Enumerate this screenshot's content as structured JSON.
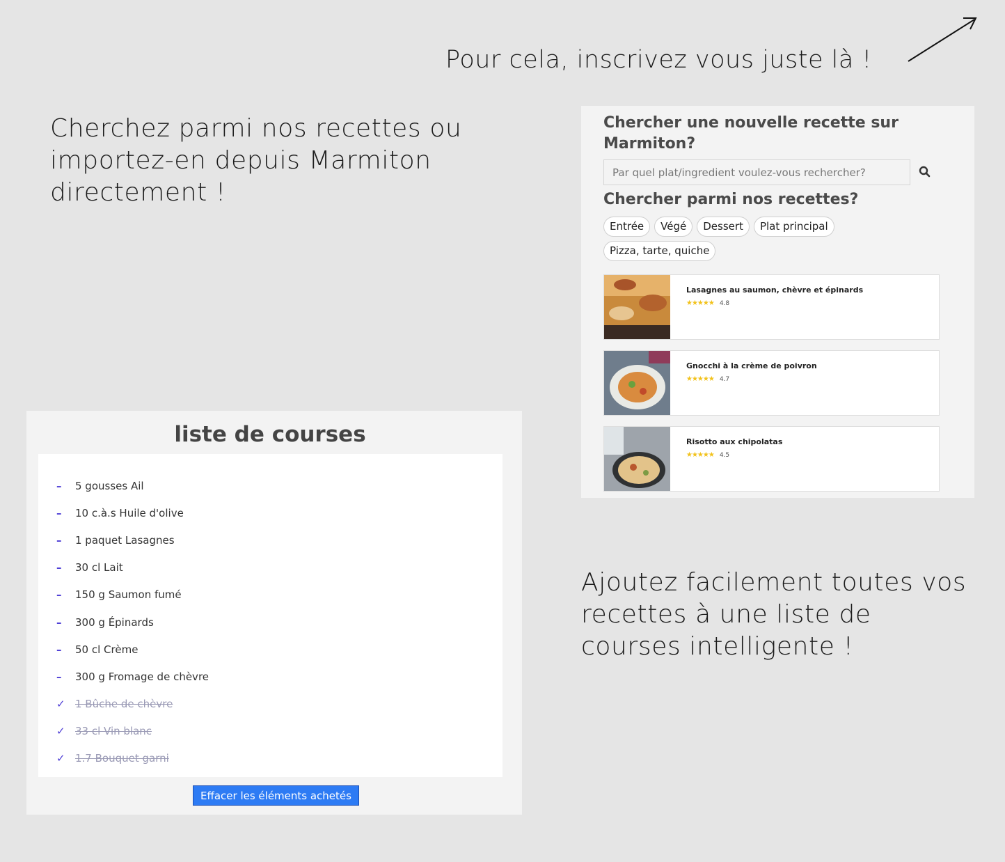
{
  "hint_top": "Pour cela, inscrivez vous juste là !",
  "intro": "Cherchez parmi nos recettes ou importez-en depuis Marmiton directement !",
  "outro": "Ajoutez facilement toutes vos recettes à une liste de courses intelligente !",
  "search_panel": {
    "title": "Chercher une nouvelle recette sur Marmiton?",
    "placeholder": "Par quel plat/ingredient voulez-vous rechercher?",
    "subtitle": "Chercher parmi nos recettes?",
    "categories": [
      "Entrée",
      "Végé",
      "Dessert",
      "Plat principal",
      "Pizza, tarte, quiche"
    ],
    "recipes": [
      {
        "name": "Lasagnes au saumon, chèvre et épinards",
        "stars": "★★★★★",
        "rating": "4.8"
      },
      {
        "name": "Gnocchi à la crème de poivron",
        "stars": "★★★★★",
        "rating": "4.7"
      },
      {
        "name": "Risotto aux chipolatas",
        "stars": "★★★★★",
        "rating": "4.5"
      }
    ],
    "star_color": "#f2c21b"
  },
  "shopping_list": {
    "title": "liste de courses",
    "pending_mark": "–",
    "done_mark": "✓",
    "items": [
      {
        "text": "5 gousses Ail",
        "done": false
      },
      {
        "text": "10 c.à.s Huile d'olive",
        "done": false
      },
      {
        "text": "1 paquet Lasagnes",
        "done": false
      },
      {
        "text": "30 cl Lait",
        "done": false
      },
      {
        "text": "150 g Saumon fumé",
        "done": false
      },
      {
        "text": "300 g Épinards",
        "done": false
      },
      {
        "text": "50 cl Crème",
        "done": false
      },
      {
        "text": "300 g Fromage de chèvre",
        "done": false
      },
      {
        "text": "1 Bûche de chèvre",
        "done": true
      },
      {
        "text": "33 cl Vin blanc",
        "done": true
      },
      {
        "text": "1.7 Bouquet garni",
        "done": true
      }
    ],
    "clear_button": "Effacer les éléments achetés",
    "accent_color": "#2d7bf4"
  }
}
